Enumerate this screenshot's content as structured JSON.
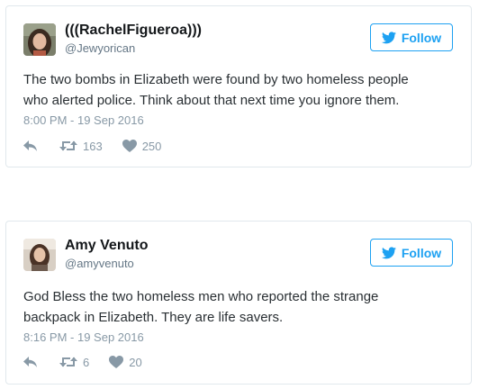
{
  "colors": {
    "accent": "#1da1f2",
    "name_text": "#14171a",
    "body_text": "#292f33",
    "secondary_text": "#8899a6",
    "handle_text": "#657786",
    "card_border": "#e1e8ed"
  },
  "icons": {
    "follow": "twitter-bird-icon",
    "reply": "reply-arrow-icon",
    "retweet": "retweet-icon",
    "like": "heart-icon"
  },
  "tweets": [
    {
      "display_name": "(((RachelFigueroa)))",
      "handle": "@Jewyorican",
      "follow_label": "Follow",
      "text_lines": [
        "The two bombs in Elizabeth were found by two homeless people",
        "who alerted police. Think about that next time you ignore them."
      ],
      "timestamp": "8:00 PM - 19 Sep 2016",
      "retweets": "163",
      "likes": "250"
    },
    {
      "display_name": "Amy Venuto",
      "handle": "@amyvenuto",
      "follow_label": "Follow",
      "text_lines": [
        "God Bless the two homeless men who reported the strange",
        "backpack in Elizabeth. They are life savers."
      ],
      "timestamp": "8:16 PM - 19 Sep 2016",
      "retweets": "6",
      "likes": "20"
    }
  ]
}
